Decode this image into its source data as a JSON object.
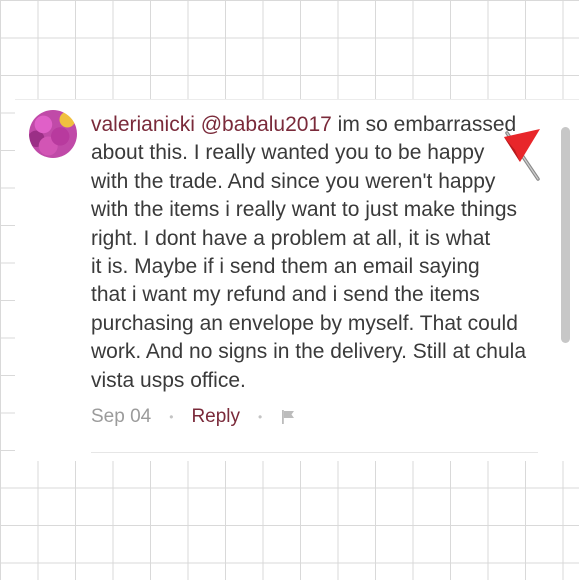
{
  "comment": {
    "username": "valerianicki",
    "mention": "@babalu2017",
    "lines": [
      " im so embarrassed",
      "about this. I really wanted you to be happy",
      "with the trade. And since you weren't happy",
      "with the items i really want to just make things",
      "right.  I dont have a problem at all, it is what",
      "it is. Maybe if i send them an email saying",
      "that i want my refund and i send the items",
      "purchasing an envelope by myself.  That could",
      "work.  And no signs in the delivery. Still at chula",
      "vista usps office."
    ],
    "emoji": "red-triangular-flag-icon",
    "date": "Sep 04",
    "separator": "•",
    "reply_label": "Reply",
    "report_icon": "flag-icon"
  },
  "colors": {
    "username": "#7a2a3a",
    "text": "#3a3a3a",
    "meta": "#9b9b9b",
    "grid": "#d9d9d9"
  }
}
